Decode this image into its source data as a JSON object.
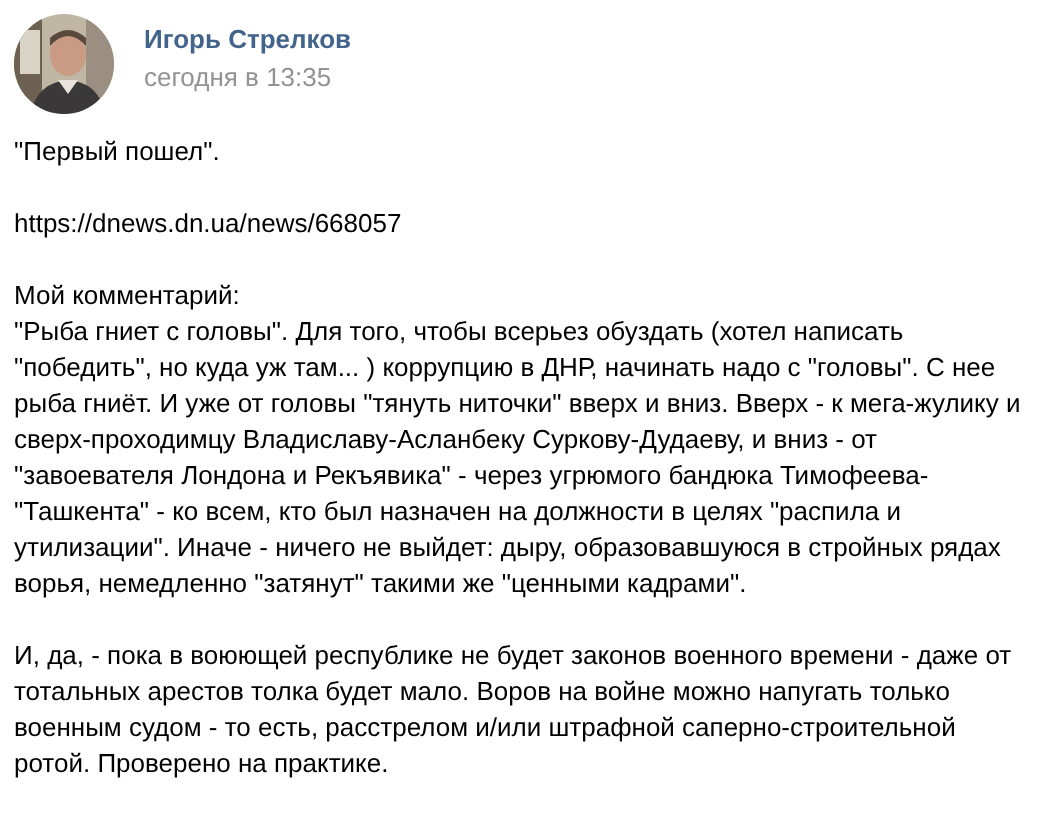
{
  "post": {
    "author": "Игорь Стрелков",
    "time": "сегодня в 13:35",
    "blocks": [
      {
        "kind": "text",
        "text": "\"Первый пошел\"."
      },
      {
        "kind": "link",
        "text": "https://dnews.dn.ua/news/668057"
      },
      {
        "kind": "text",
        "lines": [
          "Мой комментарий:",
          "\"Рыба гниет с головы\". Для того, чтобы всерьез обуздать (хотел написать \"победить\", но куда уж там... ) коррупцию в ДНР, начинать надо с \"головы\". С нее рыба гниёт. И уже от головы \"тянуть ниточки\" вверх и вниз. Вверх - к мега-жулику и сверх-проходимцу Владиславу-Асланбеку Суркову-Дудаеву, и вниз - от \"завоевателя Лондона и Рекъявика\" - через угрюмого бандюка Тимофеева-\"Ташкента\" - ко всем, кто был назначен на должности в целях \"распила и утилизации\". Иначе - ничего не выйдет: дыру, образовавшуюся в стройных рядах ворья, немедленно \"затянут\" такими же \"ценными кадрами\"."
        ]
      },
      {
        "kind": "text",
        "text": "И, да, - пока в воюющей республике не будет законов военного времени - даже от тотальных арестов толка будет мало. Воров на войне можно напугать только военным судом - то есть, расстрелом и/или штрафной саперно-строительной ротой. Проверено на практике."
      }
    ]
  }
}
